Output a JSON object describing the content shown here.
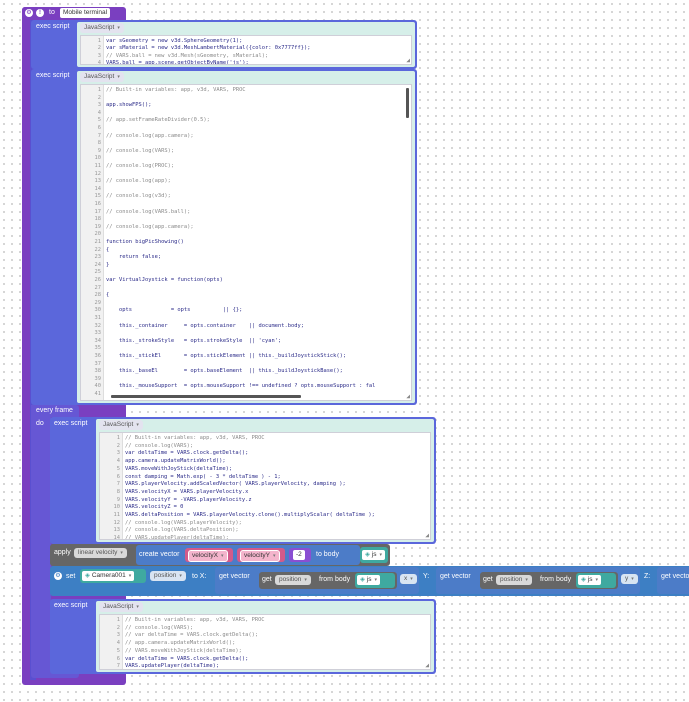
{
  "hat": {
    "label": "to",
    "target": "Mobile terminal"
  },
  "exec_label": "exec script",
  "lang_label": "JavaScript",
  "every_frame": {
    "label": "every frame",
    "do_label": "do"
  },
  "script1": {
    "lines": [
      "var sGeometry = new v3d.SphereGeometry(1);",
      "var sMaterial = new v3d.MeshLambertMaterial({color: 0x7777ff});",
      "// VARS.ball = new v3d.Mesh(sGeometry, sMaterial);",
      "VARS.ball = app.scene.getObjectByName('js');"
    ]
  },
  "script2": {
    "lines": [
      "// Built-in variables: app, v3d, VARS, PROC",
      "",
      "app.showFPS();",
      "",
      "// app.setFrameRateDivider(0.5);",
      "",
      "// console.log(app.camera);",
      "",
      "// console.log(VARS);",
      "",
      "// console.log(PROC);",
      "",
      "// console.log(app);",
      "",
      "// console.log(v3d);",
      "",
      "// console.log(VARS.ball);",
      "",
      "// console.log(app.camera);",
      "",
      "function bigPicShowing()",
      "{",
      "    return false;",
      "}",
      "",
      "var VirtualJoystick = function(opts)",
      "",
      "{",
      "",
      "    opts            = opts          || {};",
      "",
      "    this._container     = opts.container    || document.body;",
      "",
      "    this._strokeStyle   = opts.strokeStyle  || 'cyan';",
      "",
      "    this._stickEl       = opts.stickElement || this._buildJoystickStick();",
      "",
      "    this._baseEl        = opts.baseElement  || this._buildJoystickBase();",
      "",
      "    this._mouseSupport  = opts.mouseSupport !== undefined ? opts.mouseSupport : fal",
      ""
    ]
  },
  "script3": {
    "lines": [
      "// Built-in variables: app, v3d, VARS, PROC",
      "// console.log(VARS);",
      "var deltaTime = VARS.clock.getDelta();",
      "app.camera.updateMatrixWorld();",
      "VARS.moveWithJoyStick(deltaTime);",
      "const damping = Math.exp( - 3 * deltaTime ) - 1;",
      "VARS.playerVelocity.addScaledVector( VARS.playerVelocity, damping );",
      "VARS.velocityX = VARS.playerVelocity.x",
      "VARS.velocityY = -VARS.playerVelocity.z",
      "VARS.velocityZ = 0",
      "VARS.deltaPosition = VARS.playerVelocity.clone().multiplyScalar( deltaTime );",
      "// console.log(VARS.playerVelocity);",
      "// console.log(VARS.deltaPosition);",
      "// VARS.updatePlayer(deltaTime);"
    ]
  },
  "apply_block": {
    "apply_label": "apply",
    "apply_value": "linear velocity",
    "create_vector_label": "create vector",
    "var_x": "velocityX",
    "var_y": "velocityY",
    "num": "-2",
    "to_body_label": "to body",
    "body_value": "js"
  },
  "set_block": {
    "set_label": "set",
    "object": "Camera001",
    "prop": "position",
    "to_x_label": "to X:",
    "get_vector_label": "get vector",
    "get_label": "get",
    "position_label": "position",
    "from_body_label": "from body",
    "body_value": "js",
    "x_sel": "x",
    "y_label": "Y:",
    "y_sel": "y",
    "z_label": "Z:"
  },
  "script4": {
    "lines": [
      "// Built-in variables: app, v3d, VARS, PROC",
      "// console.log(VARS);",
      "// var deltaTime = VARS.clock.getDelta();",
      "// app.camera.updateMatrixWorld();",
      "// VARS.moveWithJoyStick(deltaTime);",
      "var deltaTime = VARS.clock.getDelta();",
      "VARS.updatePlayer(deltaTime);"
    ]
  },
  "colors": {
    "hat": "#7a3fc0",
    "main": "#5a4fd0",
    "exec": "#5b67db",
    "every_frame": "#6657d4",
    "apply": "#666666",
    "create_vector": "#4c7cc8",
    "set": "#3d7fc4",
    "editor_bg": "#d6efe9"
  }
}
